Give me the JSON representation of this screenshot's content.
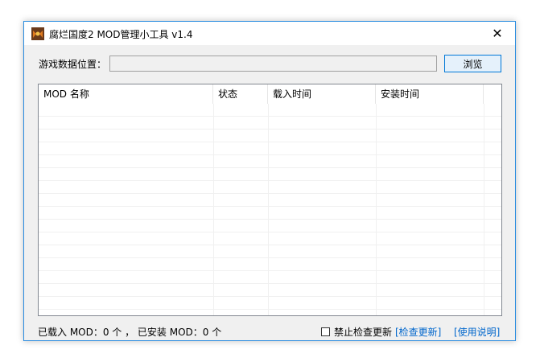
{
  "window": {
    "title": "腐烂国度2 MOD管理小工具 v1.4",
    "close_glyph": "✕",
    "accent_color": "#2b8de0"
  },
  "path": {
    "label": "游戏数据位置：",
    "value": "",
    "browse_label": "浏览"
  },
  "listview": {
    "columns": [
      "MOD 名称",
      "状态",
      "载入时间",
      "安装时间"
    ],
    "rows": []
  },
  "status": {
    "summary": "已载入 MOD：0 个 ， 已安装 MOD：0 个",
    "disable_update_check_label": "禁止检查更新",
    "disable_update_check_checked": false,
    "check_update_link": "[检查更新]",
    "help_link": "[使用说明]"
  }
}
